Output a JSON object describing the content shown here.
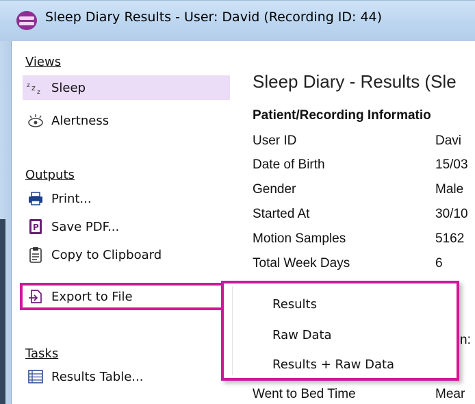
{
  "window": {
    "title": "Sleep Diary Results - User: David (Recording ID: 44)",
    "app_icon": "sleep-diary-app-icon"
  },
  "sidebar": {
    "views_heading": "Views",
    "views": [
      {
        "label": "Sleep",
        "icon": "zzz-icon",
        "selected": true
      },
      {
        "label": "Alertness",
        "icon": "alert-eye-icon",
        "selected": false
      }
    ],
    "outputs_heading": "Outputs",
    "outputs": [
      {
        "label": "Print...",
        "icon": "printer-icon"
      },
      {
        "label": "Save PDF...",
        "icon": "pdf-icon"
      },
      {
        "label": "Copy to Clipboard",
        "icon": "clipboard-icon"
      },
      {
        "label": "Export to File",
        "icon": "export-icon",
        "highlighted": true
      }
    ],
    "tasks_heading": "Tasks",
    "tasks": [
      {
        "label": "Results Table...",
        "icon": "table-icon"
      }
    ]
  },
  "main": {
    "title": "Sleep Diary - Results (Sle",
    "section_heading": "Patient/Recording Informatio",
    "rows": [
      {
        "label": "User ID",
        "value": "Davi"
      },
      {
        "label": "Date of Birth",
        "value": "15/03"
      },
      {
        "label": "Gender",
        "value": "Male"
      },
      {
        "label": "Started At",
        "value": "30/10"
      },
      {
        "label": "Motion Samples",
        "value": "5162"
      },
      {
        "label": "Total Week Days",
        "value": "6"
      }
    ],
    "partial_label_fragment": "n:",
    "bottom_row": {
      "label": "Went to Bed Time",
      "value": "Mear"
    }
  },
  "export_menu": {
    "items": [
      "Results",
      "Raw Data",
      "Results + Raw Data"
    ]
  },
  "colors": {
    "highlight_border": "#d0179b",
    "selected_bg": "#ebdcf7",
    "titlebar": "#c4dbf3"
  }
}
